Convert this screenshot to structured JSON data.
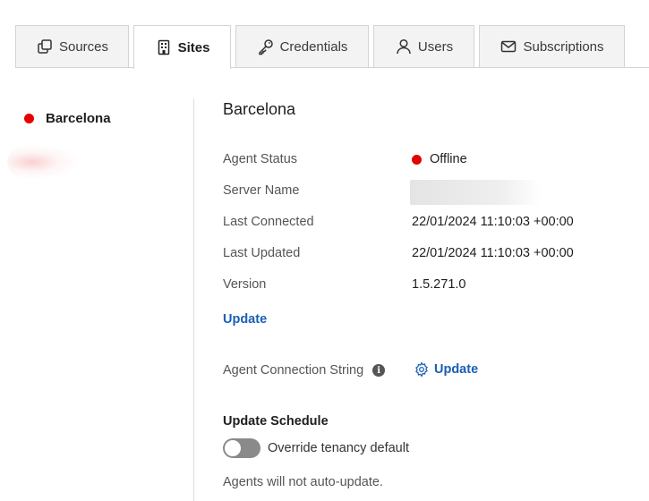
{
  "tabs": [
    {
      "label": "Sources",
      "icon": "copy-icon",
      "active": false
    },
    {
      "label": "Sites",
      "icon": "building-icon",
      "active": true
    },
    {
      "label": "Credentials",
      "icon": "key-icon",
      "active": false
    },
    {
      "label": "Users",
      "icon": "user-icon",
      "active": false
    },
    {
      "label": "Subscriptions",
      "icon": "envelope-icon",
      "active": false
    }
  ],
  "sidebar": {
    "sites": [
      {
        "name": "Barcelona",
        "status_color": "#e60000"
      }
    ]
  },
  "site": {
    "title": "Barcelona",
    "fields": {
      "agent_status": {
        "label": "Agent Status",
        "value": "Offline",
        "status_color": "#e60000"
      },
      "server_name": {
        "label": "Server Name"
      },
      "last_connected": {
        "label": "Last Connected",
        "value": "22/01/2024 11:10:03 +00:00"
      },
      "last_updated": {
        "label": "Last Updated",
        "value": "22/01/2024 11:10:03 +00:00"
      },
      "version": {
        "label": "Version",
        "value": "1.5.271.0"
      }
    },
    "update_link": "Update",
    "connection_string": {
      "label": "Agent Connection String",
      "info_icon": "info-icon",
      "action_label": "Update",
      "action_icon": "gear-icon"
    },
    "update_schedule": {
      "heading": "Update Schedule",
      "toggle_label": "Override tenancy default",
      "toggle_on": false,
      "note": "Agents will not auto-update."
    }
  },
  "colors": {
    "accent": "#1a5fb4",
    "offline": "#e60000"
  }
}
